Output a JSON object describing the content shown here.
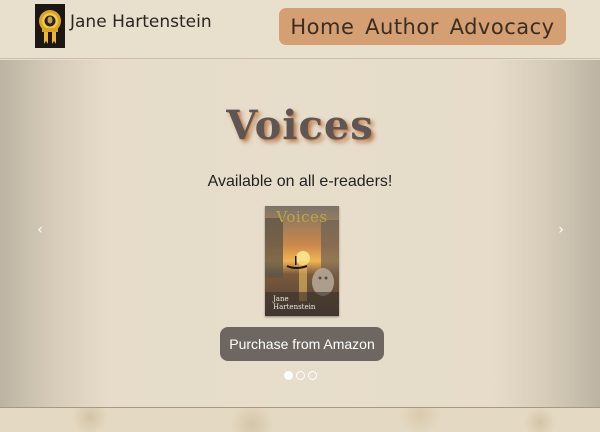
{
  "header": {
    "site_name": "Jane Hartenstein",
    "logo_icon": "award-medal-icon"
  },
  "nav": {
    "items": [
      {
        "label": "Home"
      },
      {
        "label": "Author"
      },
      {
        "label": "Advocacy"
      }
    ]
  },
  "carousel": {
    "slide_title": "Voices",
    "subtitle": "Available on all e-readers!",
    "cover": {
      "title": "Voices",
      "author_line1": "Jane",
      "author_line2": "Hartenstein"
    },
    "button_label": "Purchase from Amazon",
    "prev_icon": "chevron-left-icon",
    "next_icon": "chevron-right-icon",
    "prev_glyph": "‹",
    "next_glyph": "›",
    "slide_count": 3,
    "active_slide": 1
  },
  "colors": {
    "nav_bg": "#d49f72",
    "button_bg": "#6e6761",
    "title_shadow": "#b97a4c"
  }
}
